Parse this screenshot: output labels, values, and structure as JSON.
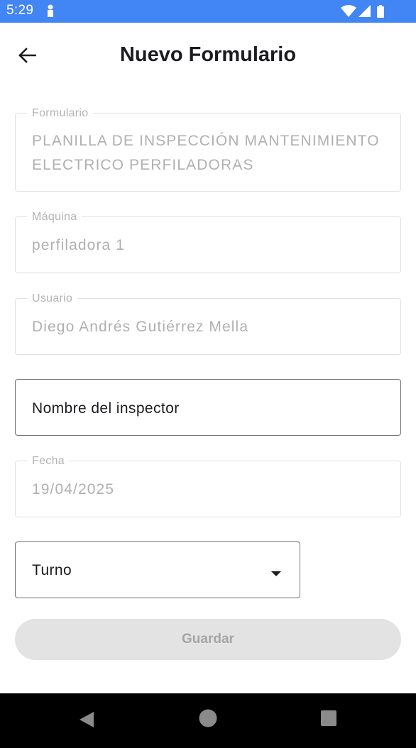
{
  "status_bar": {
    "time": "5:29",
    "icons": [
      "notification-icon",
      "wifi-icon",
      "signal-icon",
      "battery-icon"
    ],
    "background": "#4285f4"
  },
  "header": {
    "title": "Nuevo Formulario",
    "back_icon": "arrow-back-icon"
  },
  "form": {
    "formulario": {
      "label": "Formulario",
      "value": "PLANILLA DE INSPECCIÓN MANTENIMIENTO ELECTRICO PERFILADORAS"
    },
    "maquina": {
      "label": "Máquina",
      "value": "perfiladora 1"
    },
    "usuario": {
      "label": "Usuario",
      "value": "Diego Andrés Gutiérrez Mella"
    },
    "inspector": {
      "placeholder": "Nombre del inspector"
    },
    "fecha": {
      "label": "Fecha",
      "value": "19/04/2025"
    },
    "turno": {
      "label": "Turno",
      "icon": "dropdown-arrow-icon"
    }
  },
  "actions": {
    "save_label": "Guardar"
  },
  "nav_bar": {
    "icons": [
      "nav-back-icon",
      "nav-home-icon",
      "nav-recents-icon"
    ]
  }
}
